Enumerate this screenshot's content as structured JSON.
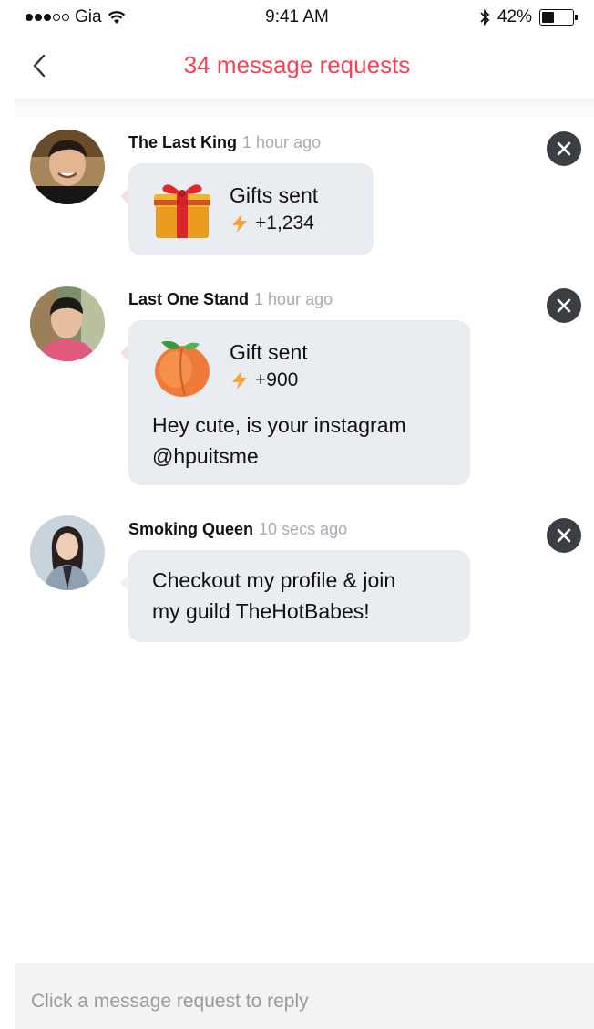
{
  "status_bar": {
    "carrier": "Gia",
    "time": "9:41 AM",
    "battery": "42%",
    "battery_level": 0.42,
    "signal_bars": 3,
    "signal_max": 5,
    "icons": [
      "signal-dots-icon",
      "wifi-icon",
      "bluetooth-icon",
      "battery-icon"
    ]
  },
  "header": {
    "title": "34 message requests",
    "title_color": "#f0455a",
    "back_icon": "chevron-left-icon"
  },
  "requests": [
    {
      "name": "The Last King",
      "time": "1 hour ago",
      "gift_title": "Gifts sent",
      "gift_amount": "+1,234",
      "gift_icon": "gift-box-icon",
      "message": ""
    },
    {
      "name": "Last One Stand",
      "time": "1 hour ago",
      "gift_title": "Gift sent",
      "gift_amount": "+900",
      "gift_icon": "peach-icon",
      "message_line1": "Hey cute, is your instagram",
      "message_line2": "@hpuitsme"
    },
    {
      "name": "Smoking Queen",
      "time": "10 secs ago",
      "message_line1": "Checkout my profile & join",
      "message_line2": "my guild TheHotBabes!"
    }
  ],
  "footer": {
    "placeholder": "Click a message request to reply"
  },
  "colors": {
    "accent": "#f0455a",
    "bubble": "#e9edf2",
    "close_button": "#3b3f44",
    "muted_text": "#a7abb3"
  }
}
